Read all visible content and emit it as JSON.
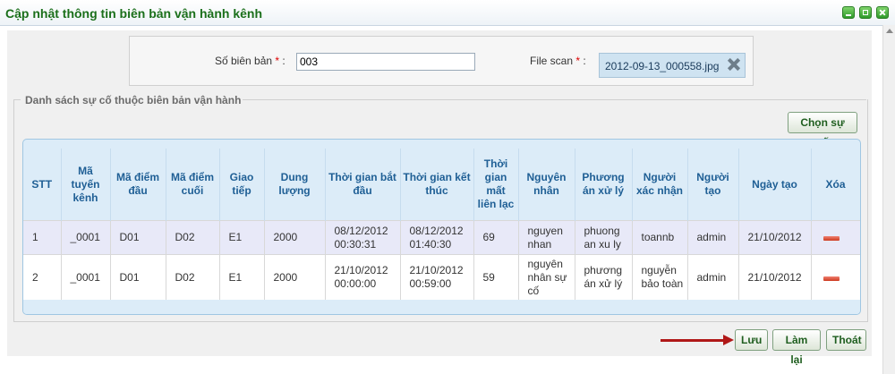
{
  "window": {
    "title": "Cập nhật thông tin biên bản vận hành kênh"
  },
  "form": {
    "so_bien_ban_label": "Số biên bản",
    "so_bien_ban_value": "003",
    "required_mark": "*",
    "colon": ":",
    "file_scan_label": "File scan",
    "file_name": "2012-09-13_000558.jpg"
  },
  "incident_section": {
    "legend": "Danh sách sự cố thuộc biên bản vận hành",
    "choose_button": "Chọn sự cố",
    "columns": [
      "STT",
      "Mã tuyến kênh",
      "Mã điểm đầu",
      "Mã điểm cuối",
      "Giao tiếp",
      "Dung lượng",
      "Thời gian bắt đầu",
      "Thời gian kết thúc",
      "Thời gian mất liên lạc",
      "Nguyên nhân",
      "Phương án xử lý",
      "Người xác nhận",
      "Người tạo",
      "Ngày tạo",
      "Xóa"
    ],
    "rows": [
      {
        "stt": "1",
        "ma_tuyen": "_0001",
        "diem_dau": "D01",
        "diem_cuoi": "D02",
        "giao_tiep": "E1",
        "dung_luong": "2000",
        "bat_dau": "08/12/2012 00:30:31",
        "ket_thuc": "08/12/2012 01:40:30",
        "mat_lien_lac": "69",
        "nguyen_nhan": "nguyen nhan",
        "phuong_an": "phuong an xu ly",
        "xac_nhan": "toannb",
        "nguoi_tao": "admin",
        "ngay_tao": "21/10/2012"
      },
      {
        "stt": "2",
        "ma_tuyen": "_0001",
        "diem_dau": "D01",
        "diem_cuoi": "D02",
        "giao_tiep": "E1",
        "dung_luong": "2000",
        "bat_dau": "21/10/2012 00:00:00",
        "ket_thuc": "21/10/2012 00:59:00",
        "mat_lien_lac": "59",
        "nguyen_nhan": "nguyên nhân sự cố",
        "phuong_an": "phương án xử lý",
        "xac_nhan": "nguyễn bảo toàn",
        "nguoi_tao": "admin",
        "ngay_tao": "21/10/2012"
      }
    ]
  },
  "footer": {
    "save": "Lưu",
    "reset": "Làm lại",
    "exit": "Thoát"
  },
  "colors": {
    "title_green": "#1a6f1a",
    "header_blue": "#1f5f95",
    "arrow_red": "#b01818"
  }
}
